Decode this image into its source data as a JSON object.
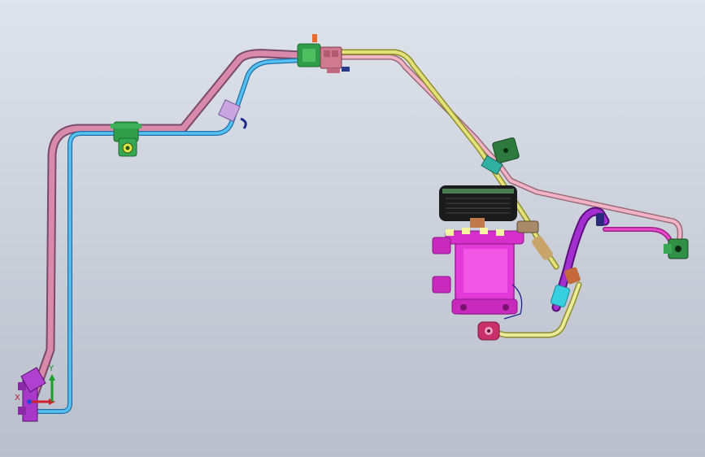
{
  "viewport": {
    "background_top": "#dfe3ec",
    "background_bottom": "#b9bfcb"
  },
  "colors": {
    "pink_tube": "#d98aaa",
    "pink_tube_dark": "#a8688a",
    "blue_tube": "#3aa6de",
    "blue_tube_dark": "#1f6fa8",
    "yellow_tube": "#d7d56a",
    "yellow_tube_dark": "#9a9a32",
    "light_pink_tube": "#e7a7b9",
    "purple_hose": "#8a1fb0",
    "magenta_body": "#e23ad6",
    "magenta_dark": "#9c1f92",
    "clamp_green": "#2f9d4a",
    "clamp_dark": "#1c6b30",
    "cyan_ferrule": "#36d0e0",
    "pulley_dark": "#1b1b1b",
    "pulley_green": "#4b7b4e",
    "brown_part": "#c46a3a",
    "axis_x": "#d01f2e",
    "axis_y": "#18a02a",
    "axis_z": "#2846d8"
  },
  "triad": {
    "x_label": "X",
    "y_label": "Y",
    "z_label": "Z"
  },
  "parts": {
    "hose_pink": "suction-hose",
    "hose_blue": "discharge-hose",
    "hose_yellow": "liquid-line",
    "compressor": "compressor-body",
    "clutch": "clutch-pulley"
  }
}
